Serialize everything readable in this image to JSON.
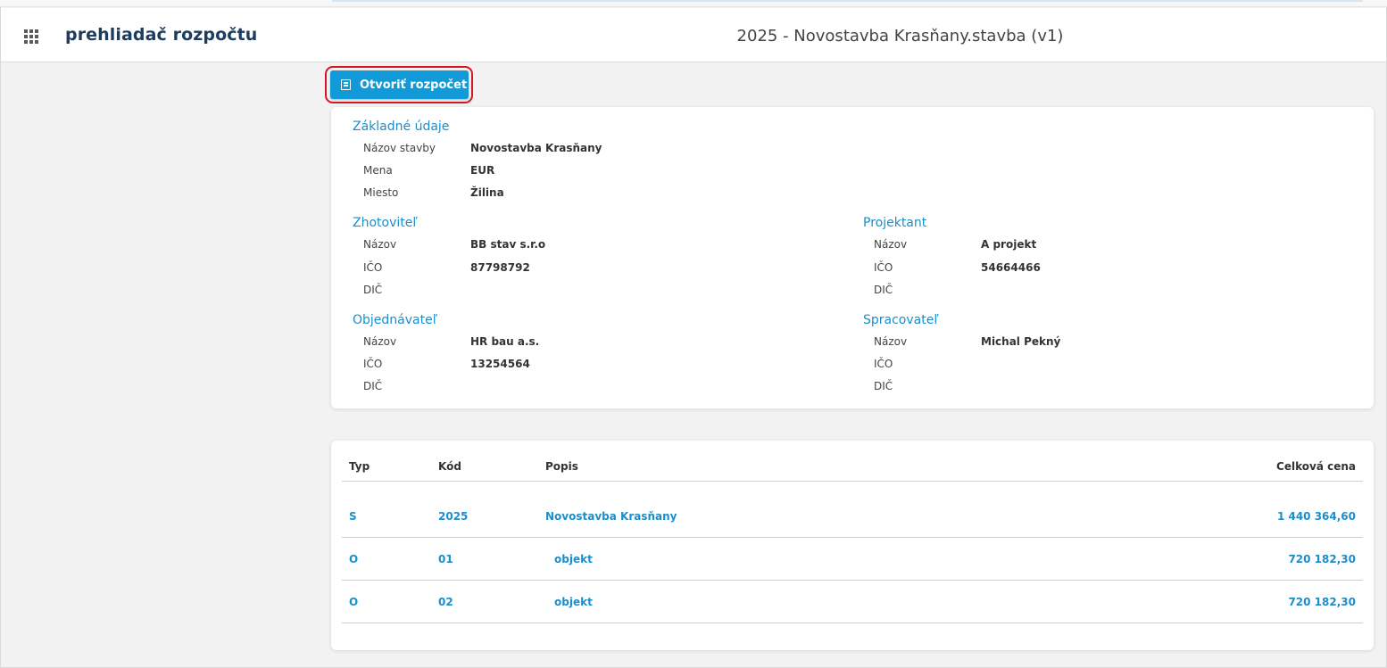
{
  "header": {
    "app_title": "prehliadač rozpočtu",
    "document_title": "2025 - Novostavba Krasňany.stavba (v1)"
  },
  "toolbar": {
    "open_button_label": "Otvoriť rozpočet"
  },
  "info": {
    "basic": {
      "title": "Základné údaje",
      "rows": [
        {
          "label": "Názov stavby",
          "value": "Novostavba Krasňany"
        },
        {
          "label": "Mena",
          "value": "EUR"
        },
        {
          "label": "Miesto",
          "value": "Žilina"
        }
      ]
    },
    "contractor": {
      "title": "Zhotoviteľ",
      "rows": [
        {
          "label": "Názov",
          "value": "BB stav s.r.o"
        },
        {
          "label": "IČO",
          "value": "87798792"
        },
        {
          "label": "DIČ",
          "value": ""
        }
      ]
    },
    "designer": {
      "title": "Projektant",
      "rows": [
        {
          "label": "Názov",
          "value": "A projekt"
        },
        {
          "label": "IČO",
          "value": "54664466"
        },
        {
          "label": "DIČ",
          "value": ""
        }
      ]
    },
    "client": {
      "title": "Objednávateľ",
      "rows": [
        {
          "label": "Názov",
          "value": "HR bau a.s."
        },
        {
          "label": "IČO",
          "value": "13254564"
        },
        {
          "label": "DIČ",
          "value": ""
        }
      ]
    },
    "processor": {
      "title": "Spracovateľ",
      "rows": [
        {
          "label": "Názov",
          "value": "Michal Pekný"
        },
        {
          "label": "IČO",
          "value": ""
        },
        {
          "label": "DIČ",
          "value": ""
        }
      ]
    }
  },
  "table": {
    "columns": [
      "Typ",
      "Kód",
      "Popis",
      "Celková cena"
    ],
    "rows": [
      {
        "type": "S",
        "code": "2025",
        "description": "Novostavba Krasňany",
        "total": "1 440 364,60"
      },
      {
        "type": "O",
        "code": "01",
        "description": "objekt",
        "total": "720 182,30"
      },
      {
        "type": "O",
        "code": "02",
        "description": "objekt",
        "total": "720 182,30"
      }
    ]
  }
}
